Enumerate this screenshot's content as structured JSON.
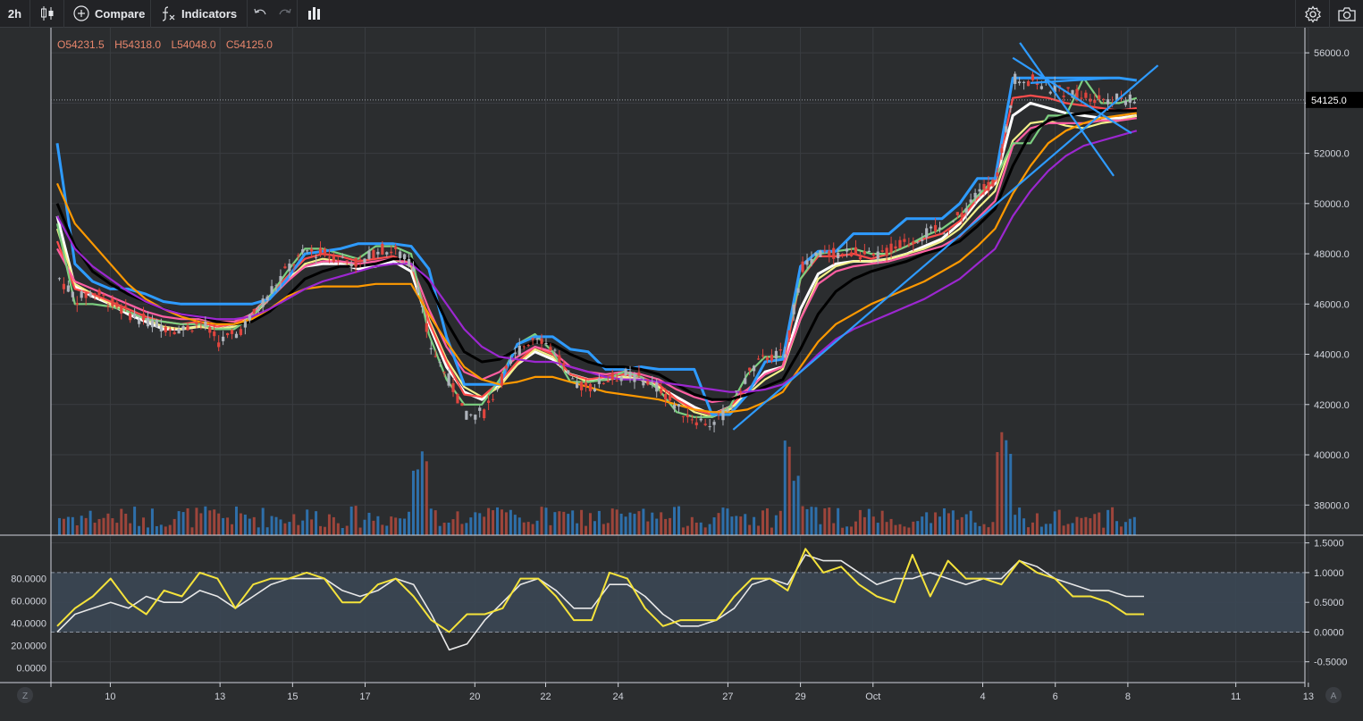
{
  "toolbar": {
    "interval": "2h",
    "compare_label": "Compare",
    "indicators_label": "Indicators",
    "icons": [
      "candles-icon",
      "plus-circle-icon",
      "fx-icon",
      "undo-icon",
      "redo-icon",
      "bars-icon",
      "gear-icon",
      "camera-icon"
    ]
  },
  "colors": {
    "background": "#2b2d2f",
    "grid": "#3a3d41",
    "up": "#aeb3bb",
    "down": "#e0453e",
    "vol_up": "#2f7bbf",
    "vol_down": "#b24a3d",
    "white_ma": "#ffffff",
    "yellow_ma": "#f2f08a",
    "red_ma": "#ff4d4d",
    "pink_ma": "#ff5fa2",
    "green_ma": "#7ccf80",
    "blue_ma": "#2e9bff",
    "black_ma": "#000000",
    "orange_ma": "#ff9900",
    "purple_ma": "#9c27d0",
    "trendline": "#2e9bff",
    "osc_white": "#e8e8e8",
    "osc_yellow": "#f5e33b",
    "osc_band": "#3b4754"
  },
  "ohlc": {
    "open": "O54231.5",
    "high": "H54318.0",
    "low": "L54048.0",
    "close": "C54125.0"
  },
  "last_price_label": "54125.0",
  "corner_labels": {
    "left": "Z",
    "right": "A"
  },
  "chart_data": [
    {
      "type": "candlestick",
      "title": "",
      "ylim": [
        36800,
        57000
      ],
      "y_ticks": [
        "56000.0",
        "54000.0",
        "52000.0",
        "50000.0",
        "48000.0",
        "46000.0",
        "44000.0",
        "42000.0",
        "40000.0",
        "38000.0"
      ],
      "x_ticks": [
        "10",
        "13",
        "15",
        "17",
        "20",
        "22",
        "24",
        "27",
        "29",
        "Oct",
        "4",
        "6",
        "8",
        "11",
        "13"
      ],
      "last_price": 54125.0,
      "price_path": {
        "x": [
          0,
          1,
          2,
          3,
          4,
          5,
          6,
          7,
          8,
          9,
          10,
          11,
          12,
          13,
          14,
          15,
          16,
          17,
          18,
          19,
          20,
          21,
          22,
          23,
          24,
          25,
          26,
          27,
          28,
          29,
          30,
          31,
          32,
          33,
          34,
          35,
          36,
          37,
          38,
          39,
          40,
          41,
          42,
          43,
          44,
          45,
          46,
          47,
          48,
          49,
          50,
          51,
          52,
          53,
          54,
          55,
          56,
          57,
          58,
          59,
          60,
          61
        ],
        "close": [
          47000,
          46200,
          46500,
          46000,
          45600,
          45300,
          45100,
          45000,
          45300,
          44500,
          44800,
          45600,
          46600,
          47500,
          48100,
          48000,
          47800,
          47600,
          48200,
          48100,
          47500,
          44300,
          43000,
          41500,
          41700,
          43000,
          44200,
          44800,
          44100,
          42800,
          42700,
          43000,
          43200,
          43000,
          42600,
          41800,
          41400,
          41200,
          42000,
          43300,
          43900,
          44000,
          47500,
          48000,
          48000,
          48100,
          47800,
          48200,
          48500,
          48800,
          49000,
          49600,
          50500,
          51000,
          55000,
          54900,
          54600,
          54400,
          54300,
          54200,
          54150,
          54125
        ]
      },
      "moving_averages": [
        {
          "color": "white",
          "y": [
            49500,
            46700,
            46300,
            46000,
            45600,
            45300,
            45000,
            45000,
            45100,
            45100,
            45200,
            45600,
            46300,
            47000,
            47500,
            47600,
            47600,
            47400,
            47500,
            47700,
            47300,
            45200,
            43500,
            42500,
            42200,
            42800,
            43600,
            44100,
            43800,
            43200,
            43000,
            43000,
            43100,
            43000,
            42700,
            42300,
            41900,
            41600,
            41900,
            42500,
            43300,
            43500,
            45800,
            47200,
            47600,
            47700,
            47700,
            47800,
            48000,
            48300,
            48600,
            49200,
            50100,
            50800,
            53500,
            54000,
            53800,
            53600,
            53500,
            53400,
            53400,
            53500
          ]
        },
        {
          "color": "yellow",
          "y": [
            49000,
            46800,
            46400,
            46000,
            45700,
            45400,
            45100,
            45000,
            45100,
            45000,
            45100,
            45500,
            46200,
            46900,
            47600,
            47800,
            47700,
            47500,
            47600,
            47800,
            47500,
            45400,
            43800,
            42700,
            42300,
            42700,
            43600,
            44200,
            43900,
            43200,
            42900,
            43000,
            43100,
            43000,
            42700,
            42200,
            41700,
            41500,
            41800,
            42400,
            43000,
            43400,
            45400,
            47000,
            47500,
            47700,
            47700,
            47800,
            48000,
            48200,
            48500,
            49000,
            49800,
            50500,
            52500,
            53200,
            53300,
            53100,
            53000,
            53200,
            53300,
            53500
          ]
        },
        {
          "color": "red",
          "y": [
            48500,
            46600,
            46400,
            46100,
            45800,
            45500,
            45300,
            45200,
            45300,
            45100,
            45200,
            45600,
            46300,
            47100,
            47800,
            48000,
            47900,
            47700,
            47800,
            47900,
            47600,
            45300,
            43700,
            42400,
            42300,
            42900,
            43700,
            44300,
            44000,
            43200,
            43000,
            43100,
            43200,
            43100,
            42800,
            42200,
            41800,
            41600,
            41900,
            42600,
            43200,
            43500,
            47000,
            47900,
            47900,
            48000,
            47800,
            48000,
            48300,
            48600,
            48800,
            49300,
            50200,
            50900,
            54200,
            54300,
            54200,
            54000,
            53900,
            53800,
            53700,
            53800
          ]
        },
        {
          "color": "pink",
          "y": [
            48200,
            46900,
            46600,
            46300,
            46000,
            45700,
            45500,
            45400,
            45400,
            45300,
            45300,
            45600,
            46200,
            46900,
            47500,
            47700,
            47700,
            47600,
            47700,
            47800,
            47600,
            45800,
            44300,
            43300,
            43000,
            43300,
            43900,
            44300,
            44100,
            43500,
            43300,
            43200,
            43300,
            43200,
            43000,
            42600,
            42300,
            42100,
            42200,
            42600,
            43200,
            43500,
            45400,
            46800,
            47300,
            47500,
            47600,
            47700,
            47900,
            48100,
            48300,
            48700,
            49400,
            50100,
            52300,
            53000,
            53200,
            53200,
            53200,
            53300,
            53300,
            53400
          ]
        },
        {
          "color": "green",
          "y": [
            49200,
            46000,
            46000,
            45900,
            45700,
            45400,
            45300,
            45200,
            45200,
            45000,
            45000,
            45500,
            46300,
            47300,
            48200,
            48200,
            48000,
            47800,
            48300,
            48300,
            48000,
            44800,
            43000,
            42000,
            42000,
            43000,
            44400,
            44800,
            44100,
            42900,
            42900,
            43000,
            43300,
            43100,
            42600,
            41700,
            41500,
            41500,
            41900,
            43200,
            43900,
            43900,
            47000,
            48000,
            48100,
            48200,
            48000,
            48000,
            48300,
            48700,
            49000,
            49500,
            50300,
            51000,
            52400,
            52400,
            53500,
            53500,
            55000,
            54000,
            54000,
            54200
          ]
        },
        {
          "color": "blue",
          "y": [
            52400,
            47600,
            46900,
            46600,
            46600,
            46400,
            46100,
            46000,
            46000,
            46000,
            46000,
            46000,
            46200,
            47000,
            48000,
            48100,
            48200,
            48400,
            48400,
            48400,
            48300,
            47400,
            44700,
            42800,
            42800,
            42800,
            44400,
            44700,
            44700,
            44200,
            44100,
            43400,
            43400,
            43500,
            43400,
            43400,
            43400,
            41600,
            41600,
            42400,
            43700,
            43800,
            47500,
            48100,
            48100,
            48800,
            48800,
            48800,
            49400,
            49400,
            49400,
            50000,
            51000,
            51000,
            55000,
            55000,
            55000,
            55000,
            55000,
            55000,
            55000,
            54900
          ]
        },
        {
          "color": "black",
          "y": [
            50000,
            48300,
            47300,
            46800,
            46400,
            46100,
            45800,
            45600,
            45500,
            45300,
            45200,
            45300,
            45700,
            46300,
            47000,
            47300,
            47500,
            47500,
            47600,
            47800,
            47800,
            46800,
            45300,
            44100,
            43700,
            43800,
            44200,
            44500,
            44400,
            44000,
            43700,
            43500,
            43500,
            43400,
            43200,
            42800,
            42400,
            42200,
            42200,
            42400,
            42700,
            43000,
            44200,
            45600,
            46500,
            47000,
            47300,
            47500,
            47700,
            48000,
            48200,
            48500,
            49100,
            49800,
            51500,
            52800,
            53300,
            53500,
            53600,
            53700,
            53700,
            53700
          ]
        },
        {
          "color": "orange",
          "y": [
            50800,
            49200,
            48400,
            47600,
            46800,
            46200,
            45800,
            45500,
            45300,
            45200,
            45200,
            45400,
            45800,
            46300,
            46600,
            46700,
            46700,
            46700,
            46800,
            46800,
            46800,
            45600,
            44500,
            43500,
            43000,
            42800,
            42900,
            43100,
            43100,
            42900,
            42700,
            42500,
            42400,
            42300,
            42200,
            42000,
            41800,
            41700,
            41700,
            41800,
            42100,
            42500,
            43500,
            44500,
            45200,
            45600,
            46000,
            46300,
            46600,
            46900,
            47300,
            47700,
            48300,
            49000,
            50400,
            51500,
            52400,
            52900,
            53200,
            53400,
            53500,
            53600
          ]
        },
        {
          "color": "purple",
          "y": [
            49500,
            48200,
            47500,
            47000,
            46500,
            46100,
            45800,
            45600,
            45500,
            45400,
            45400,
            45500,
            45800,
            46200,
            46600,
            46900,
            47100,
            47300,
            47500,
            47600,
            47600,
            47000,
            46000,
            45000,
            44300,
            43900,
            43800,
            43700,
            43700,
            43500,
            43300,
            43100,
            43000,
            43000,
            42900,
            42800,
            42700,
            42600,
            42500,
            42500,
            42600,
            42800,
            43300,
            44000,
            44600,
            45000,
            45300,
            45600,
            45900,
            46200,
            46600,
            47000,
            47600,
            48200,
            49500,
            50500,
            51300,
            51900,
            52300,
            52500,
            52700,
            52900
          ]
        }
      ],
      "trendlines": [
        {
          "x": [
            38.2,
            62.2
          ],
          "y": [
            41000,
            55500
          ]
        },
        {
          "x": [
            54.0,
            60.7
          ],
          "y": [
            55800,
            52800
          ]
        },
        {
          "x": [
            54.4,
            59.7
          ],
          "y": [
            56400,
            51100
          ]
        },
        {
          "x": [
            55.0,
            59.6
          ],
          "y": [
            54800,
            55000
          ]
        }
      ]
    },
    {
      "type": "line",
      "title": "",
      "ylim": [
        -0.85,
        1.6
      ],
      "left_ticks": [
        "80.0000",
        "60.0000",
        "40.0000",
        "20.0000",
        "0.0000"
      ],
      "right_ticks": [
        "1.5000",
        "1.0000",
        "0.5000",
        "0.0000",
        "-0.5000"
      ],
      "band": [
        0.0,
        1.0
      ],
      "series": [
        {
          "color": "white",
          "values": [
            0.0,
            0.3,
            0.4,
            0.5,
            0.4,
            0.6,
            0.5,
            0.5,
            0.7,
            0.6,
            0.4,
            0.6,
            0.8,
            0.9,
            0.9,
            0.9,
            0.7,
            0.6,
            0.7,
            0.9,
            0.8,
            0.3,
            -0.3,
            -0.2,
            0.2,
            0.5,
            0.8,
            0.9,
            0.7,
            0.4,
            0.4,
            0.8,
            0.8,
            0.6,
            0.3,
            0.1,
            0.1,
            0.2,
            0.4,
            0.8,
            0.9,
            0.8,
            1.3,
            1.2,
            1.2,
            1.0,
            0.8,
            0.9,
            0.9,
            1.0,
            0.9,
            0.8,
            0.9,
            0.9,
            1.2,
            1.1,
            0.9,
            0.8,
            0.7,
            0.7,
            0.6,
            0.6
          ]
        },
        {
          "color": "yellow",
          "values": [
            0.1,
            0.4,
            0.6,
            0.9,
            0.5,
            0.3,
            0.7,
            0.6,
            1.0,
            0.9,
            0.4,
            0.8,
            0.9,
            0.9,
            1.0,
            0.9,
            0.5,
            0.5,
            0.8,
            0.9,
            0.6,
            0.2,
            0.0,
            0.3,
            0.3,
            0.4,
            0.9,
            0.9,
            0.6,
            0.2,
            0.2,
            1.0,
            0.9,
            0.4,
            0.1,
            0.2,
            0.2,
            0.2,
            0.6,
            0.9,
            0.9,
            0.7,
            1.4,
            1.0,
            1.1,
            0.8,
            0.6,
            0.5,
            1.3,
            0.6,
            1.2,
            0.9,
            0.9,
            0.8,
            1.2,
            1.0,
            0.9,
            0.6,
            0.6,
            0.5,
            0.3,
            0.3
          ]
        }
      ]
    }
  ]
}
